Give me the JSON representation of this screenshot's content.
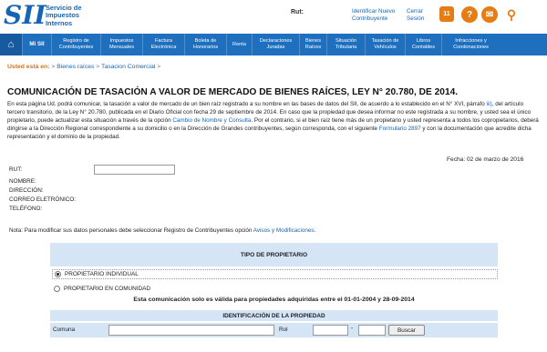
{
  "header": {
    "logo_mark": "SII",
    "logo_lines": [
      "Servicio de",
      "Impuestos",
      "Internos"
    ],
    "rut_label": "Rut:",
    "link_identify": "Identificar Nuevo Contribuyente",
    "link_logout": "Cerrar Sesión",
    "icons": [
      "calendar-icon",
      "help-icon",
      "mail-icon",
      "search-icon"
    ],
    "calendar_day": "11"
  },
  "nav": {
    "home_icon": "home-icon",
    "items": [
      "Mi SII",
      "Registro de Contribuyentes",
      "Impuestos Mensuales",
      "Factura Electrónica",
      "Boleta de Honorarios",
      "Renta",
      "Declaraciones Juradas",
      "Bienes Raíces",
      "Situación Tributaria",
      "Tasación de Vehículos",
      "Libros Contables",
      "Infracciones y Condonaciones"
    ]
  },
  "breadcrumb": {
    "label": "Usted está en:",
    "items": [
      "Bienes raíces",
      "Tasacion Comercial"
    ]
  },
  "page": {
    "title": "COMUNICACIÓN DE TASACIÓN A VALOR DE MERCADO DE BIENES RAÍCES, LEY N° 20.780, DE 2014.",
    "intro_1": "En esta página Ud. podrá comunicar, la tasación a valor de mercado de un bien raíz registrado a su nombre en las bases de datos del SII, de acuerdo a lo establecido en el N° XVI, párrafo",
    "intro_link_1": "iii)",
    "intro_2": ", del artículo tercero transitorio, de la Ley N° 20.780, publicada en el Diario Oficial con fecha 29 de septiembre de 2014. En caso que la propiedad que desea informar no este registrada a su nombre, y usted sea el único propietario, puede actualizar esta situación a través de la opción",
    "intro_link_2": "Cambio de Nombre y Consulta",
    "intro_3": ". Por el contrario, si el bien raíz tiene más de un propietario y usted representa a todos los copropietarios, deberá dirigirse a la Dirección Regional correspondiente a su domicilio o en la Dirección de Grandes contribuyentes, según corresponda, con el siguiente",
    "intro_link_3": "Formulario 2897",
    "intro_4": "y con la documentación que acredite dicha representación y el dominio de la propiedad.",
    "fecha": "Fecha: 02 de marzo de 2016"
  },
  "form": {
    "rut_label": "RUT:",
    "nombre_label": "NOMBRE:",
    "direccion_label": "DIRECCIÓN:",
    "correo_label": "CORREO ELETRÓNICO:",
    "telefono_label": "TELÉFONO:",
    "note_text": "Nota: Para modificar sus datos personales debe seleccionar Registro de Contribuyentes opción",
    "note_link": "Avisos y Modificaciones",
    "note_end": "."
  },
  "owner": {
    "header": "TIPO DE PROPIETARIO",
    "option_individual": "PROPIETARIO INDIVIDUAL",
    "option_comunidad": "PROPIETARIO EN COMUNIDAD",
    "selected": "PROPIETARIO INDIVIDUAL",
    "validity": "Esta comunicación solo es válida para propiedades adquiridas entre el 01-01-2004 y 28-09-2014"
  },
  "property": {
    "header": "IDENTIFICACIÓN DE LA PROPIEDAD",
    "comuna_label": "Comuna",
    "rol_label": "Rol",
    "dash": "-",
    "search_button": "Buscar"
  }
}
